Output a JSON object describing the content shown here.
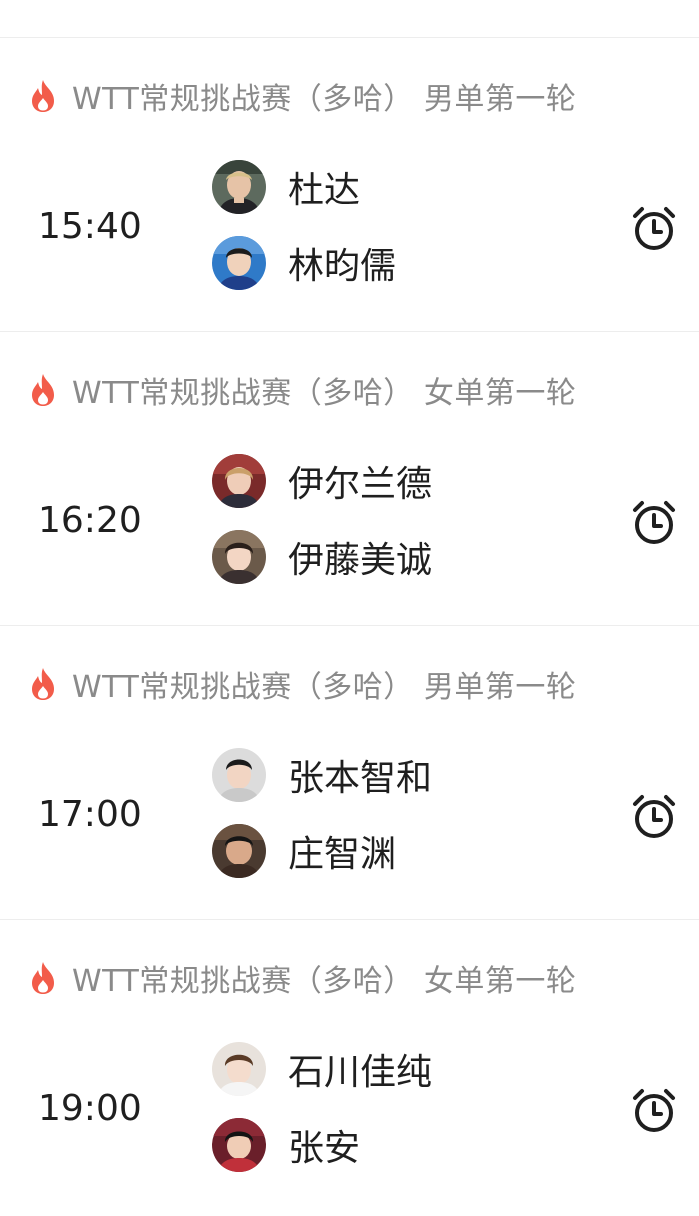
{
  "matches": [
    {
      "event": "WTT常规挑战赛（多哈） 男单第一轮",
      "time": "15:40",
      "player1": "杜达",
      "player2": "林昀儒"
    },
    {
      "event": "WTT常规挑战赛（多哈） 女单第一轮",
      "time": "16:20",
      "player1": "伊尔兰德",
      "player2": "伊藤美诚"
    },
    {
      "event": "WTT常规挑战赛（多哈） 男单第一轮",
      "time": "17:00",
      "player1": "张本智和",
      "player2": "庄智渊"
    },
    {
      "event": "WTT常规挑战赛（多哈） 女单第一轮",
      "time": "19:00",
      "player1": "石川佳纯",
      "player2": "张安"
    }
  ],
  "colors": {
    "fire": "#f25c4a",
    "event_text": "#8a8a8a",
    "primary_text": "#1f1f1f",
    "divider": "#ededed"
  },
  "icons": {
    "event": "fire-icon",
    "reminder": "alarm-clock-icon",
    "player": "avatar"
  }
}
